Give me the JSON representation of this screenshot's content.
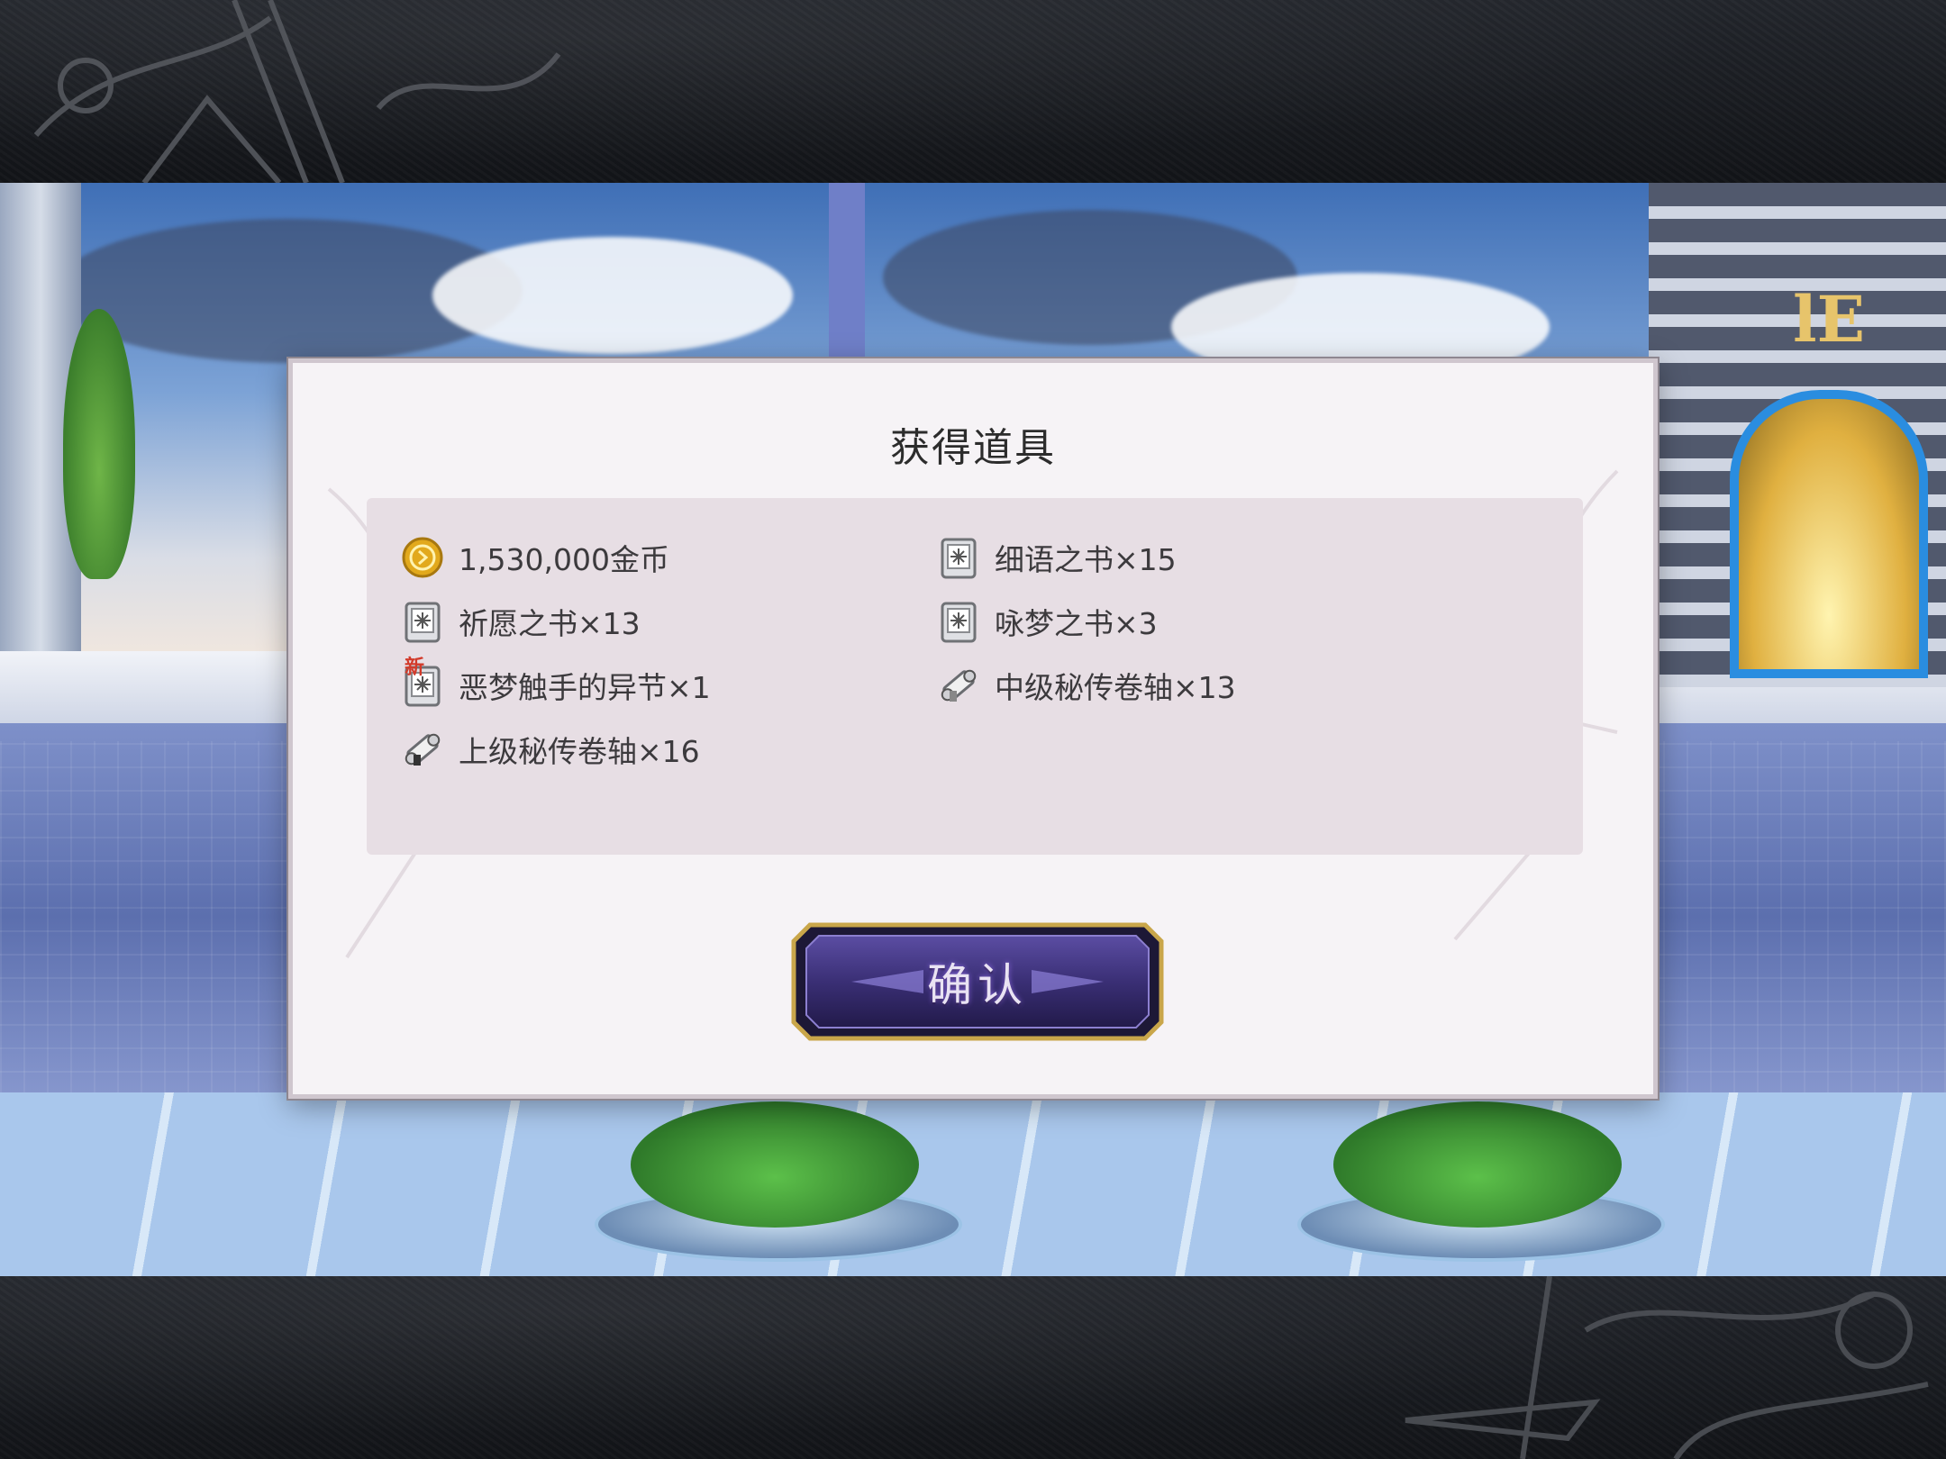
{
  "dialog": {
    "title": "获得道具",
    "confirm_label": "确认"
  },
  "rewards": {
    "left": [
      {
        "icon": "gold-coin-icon",
        "label": "1,530,000金币",
        "new": false
      },
      {
        "icon": "book-icon",
        "label": "祈愿之书×13",
        "new": false
      },
      {
        "icon": "book-icon",
        "label": "恶梦触手的异节×1",
        "new": true
      },
      {
        "icon": "scroll-icon",
        "label": "上级秘传卷轴×16",
        "new": false
      }
    ],
    "right": [
      {
        "icon": "book-icon",
        "label": "细语之书×15",
        "new": false
      },
      {
        "icon": "book-icon",
        "label": "咏梦之书×3",
        "new": false
      },
      {
        "icon": "scroll-icon",
        "label": "中级秘传卷轴×13",
        "new": false
      }
    ],
    "new_badge": "新"
  },
  "scene": {
    "door_sign": "lE"
  },
  "colors": {
    "accent_button": "#4b3f8c",
    "button_border": "#c9a64a",
    "new_badge": "#d23a2a"
  }
}
